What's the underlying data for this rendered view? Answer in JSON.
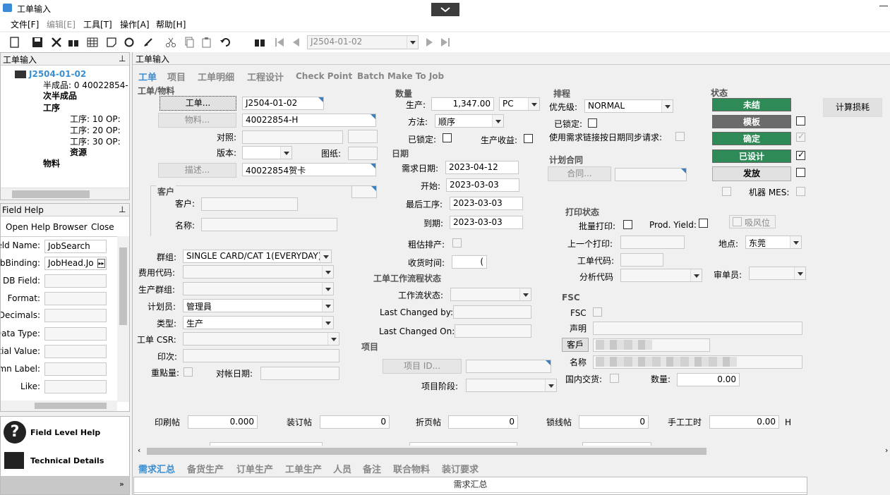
{
  "window": {
    "title": "工单输入"
  },
  "menu": [
    "文件[F]",
    "编辑[E]",
    "工具[T]",
    "操作[A]",
    "帮助[H]"
  ],
  "toolbar": {
    "job_nav_value": "J2504-01-02"
  },
  "tree_panel": {
    "title": "工单输入",
    "root": "J2504-01-02",
    "semi": "半成品: 0 40022854-",
    "semi_label": "次半成品",
    "ops": "工序",
    "op10": "工序: 10 OP:",
    "op20": "工序: 20 OP:",
    "op30": "工序: 30 OP:",
    "resource": "资源",
    "material": "物料"
  },
  "field_help": {
    "title": "Field Help",
    "open_browser": "Open Help Browser",
    "close": "Close",
    "rows": [
      {
        "label": "eld Name:",
        "value": "JobSearch"
      },
      {
        "label": "bBinding:",
        "value": "JobHead.Jo"
      },
      {
        "label": "DB Field:",
        "value": ""
      },
      {
        "label": "Format:",
        "value": ""
      },
      {
        "label": "Decimals:",
        "value": ""
      },
      {
        "label": "Data Type:",
        "value": ""
      },
      {
        "label": "tial Value:",
        "value": ""
      },
      {
        "label": "mn Label:",
        "value": ""
      },
      {
        "label": "Like:",
        "value": ""
      }
    ],
    "level_help": "Field Level Help",
    "tech_details": "Technical Details"
  },
  "main": {
    "panel_title": "工单输入",
    "tabs": [
      "工单",
      "项目",
      "工单明细",
      "工程设计",
      "Check Point",
      "Batch Make To Job"
    ],
    "job_material": {
      "section": "工单/物料",
      "job_btn": "工单...",
      "job_value": "J2504-01-02",
      "part_btn": "物料...",
      "part_value": "40022854-H",
      "ref_label": "对照:",
      "rev_label": "版本:",
      "drawing_label": "图纸:",
      "desc_btn": "描述...",
      "desc_value": "40022854贺卡"
    },
    "customer": {
      "section": "客户",
      "cust_label": "客户:",
      "name_label": "名称:"
    },
    "fields": {
      "group_label": "群组:",
      "group_value": "SINGLE CARD/CAT 1(EVERYDAY)",
      "cost_label": "费用代码:",
      "prod_group_label": "生产群组:",
      "planner_label": "计划员:",
      "planner_value": "管理員",
      "type_label": "类型:",
      "type_value": "生产",
      "csr_label": "工单 CSR:",
      "print_label": "印次:",
      "key_label": "重點量:",
      "reconcile_label": "对帐日期:"
    },
    "quantity": {
      "section": "数量",
      "prod_label": "生产:",
      "prod_value": "1,347.00",
      "uom": "PC",
      "method_label": "方法:",
      "method_value": "顺序",
      "locked_label": "已锁定:",
      "yield_label": "生产收益:"
    },
    "dates": {
      "section": "日期",
      "req_label": "需求日期:",
      "req_value": "2023-04-12",
      "start_label": "开始:",
      "start_value": "2023-03-03",
      "last_op_label": "最后工序:",
      "last_op_value": "2023-03-03",
      "due_label": "到期:",
      "due_value": "2023-03-03",
      "rough_label": "粗估排产:",
      "receive_label": "收货时间:",
      "receive_value": "("
    },
    "workflow": {
      "section": "工单工作流程状态",
      "state_label": "工作流状态:",
      "changed_by_label": "Last Changed by:",
      "changed_on_label": "Last Changed On:"
    },
    "project": {
      "section": "项目",
      "btn": "项目 ID...",
      "phase_label": "项目阶段:"
    },
    "schedule": {
      "section": "排程",
      "priority_label": "优先级:",
      "priority_value": "NORMAL",
      "locked_label": "已锁定:",
      "sync_label": "使用需求链接按日期同步请求:"
    },
    "contract": {
      "section": "计划合同",
      "btn": "合同..."
    },
    "print_status": {
      "section": "打印状态",
      "batch_label": "批量打印:",
      "yield_label": "Prod. Yield:",
      "suction": "吸风位",
      "prev_print_label": "上一个打印:",
      "location_label": "地点:",
      "location_value": "东莞",
      "job_code_label": "工单代码:",
      "analysis_label": "分析代码",
      "reviewer_label": "审单员:"
    },
    "fsc": {
      "section": "FSC",
      "fsc_label": "FSC",
      "statement_label": "声明",
      "customer_btn": "客戶",
      "name_label": "名称",
      "domestic_label": "国内交货:",
      "qty_label": "数量:",
      "qty_value": "0.00"
    },
    "status": {
      "section": "状态",
      "open": "未结",
      "template": "模板",
      "confirmed": "确定",
      "engineered": "已设计",
      "released": "发放",
      "machine_mes": "机器 MES:",
      "calc_btn": "计算损耗",
      "open_color": "#2e8b57",
      "template_color": "#6b6b6b"
    },
    "bottom": {
      "print_post_label": "印刷帖",
      "print_post_value": "0.000",
      "bind_label": "装订帖",
      "bind_value": "0",
      "fold_label": "折页帖",
      "fold_value": "0",
      "sew_label": "锁线帖",
      "sew_value": "0",
      "manual_label": "手工工时",
      "manual_value": "0.00",
      "unit": "H"
    }
  },
  "bottom_tabs": [
    "需求汇总",
    "备货生产",
    "订单生产",
    "工单生产",
    "人员",
    "备注",
    "联合物料",
    "装订要求"
  ],
  "bottom_grid_header": "需求汇总"
}
